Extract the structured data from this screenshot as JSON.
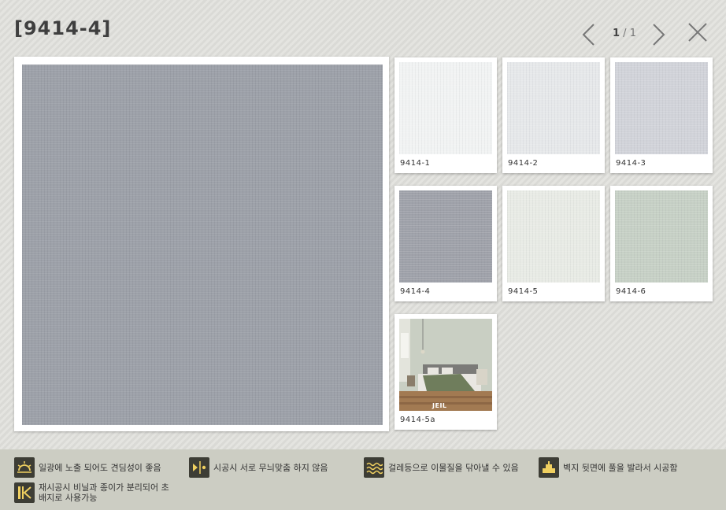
{
  "header": {
    "title": "[9414-4]",
    "pager_current": "1",
    "pager_sep": " / ",
    "pager_total": "1"
  },
  "thumbnails": [
    {
      "label": "9414-1",
      "color": "#f1f3f3"
    },
    {
      "label": "9414-2",
      "color": "#e6e8ea"
    },
    {
      "label": "9414-3",
      "color": "#d1d3d9"
    },
    {
      "label": "9414-4",
      "color": "#9ea1a9"
    },
    {
      "label": "9414-5",
      "color": "#e8ebe5"
    },
    {
      "label": "9414-6",
      "color": "#c6d0c5"
    },
    {
      "label": "9414-5a",
      "color": "#c9cfc3"
    }
  ],
  "main_swatch_color": "#9da1a9",
  "features": [
    {
      "icon": "sun-icon",
      "text": "일광에 노출 되어도 견딤성이 좋음"
    },
    {
      "icon": "pattern-match-icon",
      "text": "시공시 서로 무늬맞춤 하지 않음"
    },
    {
      "icon": "wave-icon",
      "text": "걸레등으로 이물질을 닦아낼 수 있음"
    },
    {
      "icon": "paste-back-icon",
      "text": "벽지 뒷면에 풀을 발라서 시공함"
    },
    {
      "icon": "peelable-icon",
      "text_line1": "재시공시 비닐과 종이가 분리되어 초",
      "text_line2": "배지로 사용가능"
    }
  ],
  "photo_brand": "JEIL"
}
